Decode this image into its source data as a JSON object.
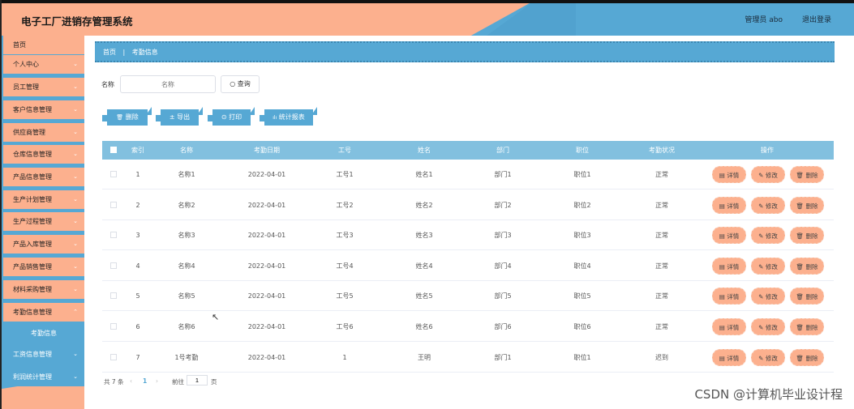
{
  "app_title": "电子工厂进销存管理系统",
  "header": {
    "user": "管理员 abo",
    "logout": "退出登录"
  },
  "sidebar": {
    "items": [
      {
        "label": "首页",
        "chev": ""
      },
      {
        "label": "个人中心",
        "chev": "⌄"
      },
      {
        "label": "员工管理",
        "chev": "⌄"
      },
      {
        "label": "客户信息管理",
        "chev": "⌄"
      },
      {
        "label": "供应商管理",
        "chev": "⌄"
      },
      {
        "label": "仓库信息管理",
        "chev": "⌄"
      },
      {
        "label": "产品信息管理",
        "chev": "⌄"
      },
      {
        "label": "生产计划管理",
        "chev": "⌄"
      },
      {
        "label": "生产过程管理",
        "chev": "⌄"
      },
      {
        "label": "产品入库管理",
        "chev": "⌄"
      },
      {
        "label": "产品销售管理",
        "chev": "⌄"
      },
      {
        "label": "材料采购管理",
        "chev": "⌄"
      },
      {
        "label": "考勤信息管理",
        "chev": "⌃"
      },
      {
        "label": "考勤信息",
        "chev": ""
      },
      {
        "label": "工资信息管理",
        "chev": "⌄"
      },
      {
        "label": "利润统计管理",
        "chev": "⌄"
      }
    ]
  },
  "breadcrumb": {
    "home": "首页",
    "sep": "|",
    "current": "考勤信息"
  },
  "search": {
    "label": "名称",
    "placeholder": "名称",
    "value": "",
    "button": "查询",
    "button_icon": "○"
  },
  "actions": {
    "delete": "删除",
    "delete_icon": "🗑",
    "export": "导出",
    "export_icon": "±",
    "print": "打印",
    "print_icon": "⊙",
    "stats": "统计报表",
    "stats_icon": "ılı"
  },
  "table": {
    "headers": [
      "索引",
      "名称",
      "考勤日期",
      "工号",
      "姓名",
      "部门",
      "职位",
      "考勤状况",
      "操作"
    ],
    "rows": [
      {
        "idx": "1",
        "name": "名称1",
        "date": "2022-04-01",
        "no": "工号1",
        "person": "姓名1",
        "dept": "部门1",
        "pos": "职位1",
        "status": "正常"
      },
      {
        "idx": "2",
        "name": "名称2",
        "date": "2022-04-01",
        "no": "工号2",
        "person": "姓名2",
        "dept": "部门2",
        "pos": "职位2",
        "status": "正常"
      },
      {
        "idx": "3",
        "name": "名称3",
        "date": "2022-04-01",
        "no": "工号3",
        "person": "姓名3",
        "dept": "部门3",
        "pos": "职位3",
        "status": "正常"
      },
      {
        "idx": "4",
        "name": "名称4",
        "date": "2022-04-01",
        "no": "工号4",
        "person": "姓名4",
        "dept": "部门4",
        "pos": "职位4",
        "status": "正常"
      },
      {
        "idx": "5",
        "name": "名称5",
        "date": "2022-04-01",
        "no": "工号5",
        "person": "姓名5",
        "dept": "部门5",
        "pos": "职位5",
        "status": "正常"
      },
      {
        "idx": "6",
        "name": "名称6",
        "date": "2022-04-01",
        "no": "工号6",
        "person": "姓名6",
        "dept": "部门6",
        "pos": "职位6",
        "status": "正常"
      },
      {
        "idx": "7",
        "name": "1号考勤",
        "date": "2022-04-01",
        "no": "1",
        "person": "王明",
        "dept": "部门1",
        "pos": "职位1",
        "status": "迟到"
      }
    ],
    "ops": {
      "detail": "详情",
      "detail_icon": "▤",
      "edit": "修改",
      "edit_icon": "✎",
      "del": "删除",
      "del_icon": "🗑"
    }
  },
  "pagination": {
    "total": "共 7 条",
    "prev": "‹",
    "page": "1",
    "next": "›",
    "goto_label": "前往",
    "goto_value": "1",
    "page_unit": "页"
  },
  "watermark": "CSDN @计算机毕业设计程",
  "colors": {
    "salmon": "#fcb08e",
    "blue": "#56a8d4",
    "table_head": "#82c0df"
  }
}
